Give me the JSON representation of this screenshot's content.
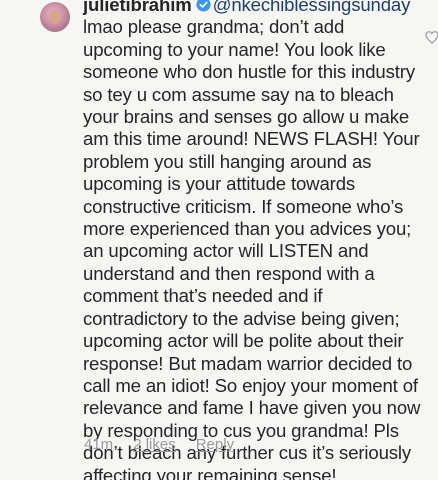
{
  "comment": {
    "username": "julietibrahim",
    "mention": "@nkechiblessingsunday",
    "text": "lmao please grandma; don’t add upcoming to your name! You look like someone who don hustle for this industry so tey u com assume say na to bleach your brains and senses go allow u make am this time around! NEWS FLASH! Your problem you still hanging around as upcoming is your attitude towards constructive criticism. If someone who’s more experienced than you advices you; an upcoming actor will LISTEN and understand and then respond with a comment that’s needed and if contradictory to the advise being given; upcoming actor will be polite about their response! But madam warrior decided to call me an idiot! So enjoy your moment of relevance and fame I have given you now by responding to cus you grandma! Pls don’t bleach any further cus it’s seriously affecting your remaining sense!",
    "timestamp": "41m",
    "likes": "2 likes",
    "reply": "Reply"
  },
  "icons": {
    "verified": "verified-badge-icon",
    "like": "heart-outline-icon"
  },
  "colors": {
    "verified": "#3897f0",
    "mention": "#1f3f6c",
    "meta": "#9a9a9a"
  }
}
